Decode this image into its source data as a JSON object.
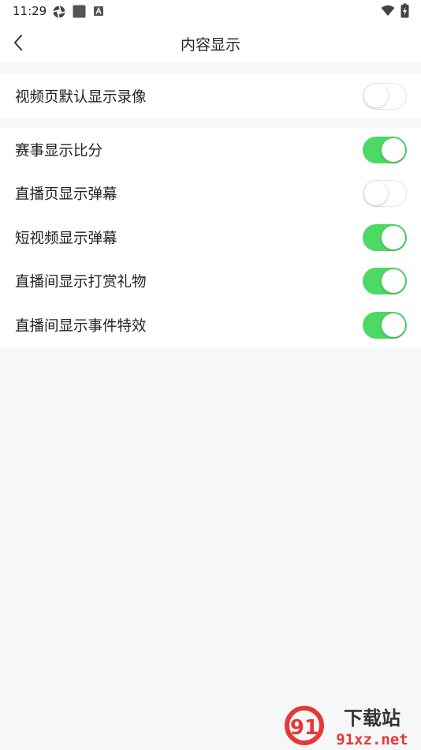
{
  "status_bar": {
    "time": "11:29",
    "icons": [
      "activity-ring-icon",
      "square-app-icon",
      "a-notification-icon",
      "wifi-icon",
      "battery-charging-icon"
    ]
  },
  "header": {
    "title": "内容显示",
    "back_icon": "chevron-left-icon"
  },
  "groups": [
    {
      "items": [
        {
          "label": "视频页默认显示录像",
          "enabled": false
        }
      ]
    },
    {
      "items": [
        {
          "label": "赛事显示比分",
          "enabled": true
        },
        {
          "label": "直播页显示弹幕",
          "enabled": false
        },
        {
          "label": "短视频显示弹幕",
          "enabled": true
        },
        {
          "label": "直播间显示打赏礼物",
          "enabled": true
        },
        {
          "label": "直播间显示事件特效",
          "enabled": true
        }
      ]
    }
  ],
  "watermark": {
    "text": "下载站",
    "domain": "91xz.net",
    "logo": "91"
  },
  "colors": {
    "toggle_on": "#4cd964",
    "background": "#f6f7f9",
    "watermark_red": "#e53935"
  }
}
